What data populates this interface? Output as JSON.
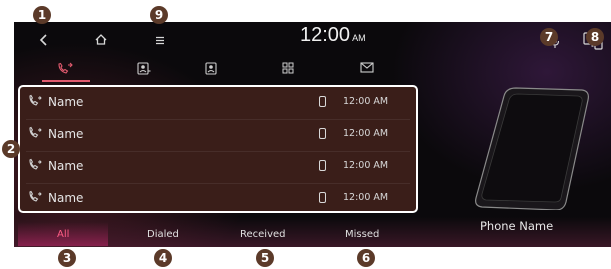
{
  "callouts": [
    "1",
    "2",
    "3",
    "4",
    "5",
    "6",
    "7",
    "8",
    "9"
  ],
  "top_bar": {
    "back_icon": "back-chevron-icon",
    "home_icon": "home-icon",
    "menu_icon": "menu-icon",
    "clock_time": "12:00",
    "clock_ampm": "AM",
    "mic_icon": "microphone-icon",
    "switch_icon": "phone-switch-icon"
  },
  "tabs": [
    {
      "name": "call-history",
      "icon": "call-history-icon",
      "active": true
    },
    {
      "name": "contacts",
      "icon": "contacts-icon",
      "active": false
    },
    {
      "name": "favorites",
      "icon": "favorites-icon",
      "active": false
    },
    {
      "name": "keypad",
      "icon": "keypad-icon",
      "active": false
    },
    {
      "name": "messages",
      "icon": "message-icon",
      "active": false
    }
  ],
  "call_list": [
    {
      "name": "Name",
      "time": "12:00 AM"
    },
    {
      "name": "Name",
      "time": "12:00 AM"
    },
    {
      "name": "Name",
      "time": "12:00 AM"
    },
    {
      "name": "Name",
      "time": "12:00 AM"
    }
  ],
  "filters": [
    {
      "label": "All",
      "active": true
    },
    {
      "label": "Dialed",
      "active": false
    },
    {
      "label": "Received",
      "active": false
    },
    {
      "label": "Missed",
      "active": false
    }
  ],
  "device": {
    "phone_name": "Phone Name"
  },
  "colors": {
    "accent": "#e05a6e",
    "callout": "#5b3a29",
    "list_bg": "#3a1e19"
  }
}
